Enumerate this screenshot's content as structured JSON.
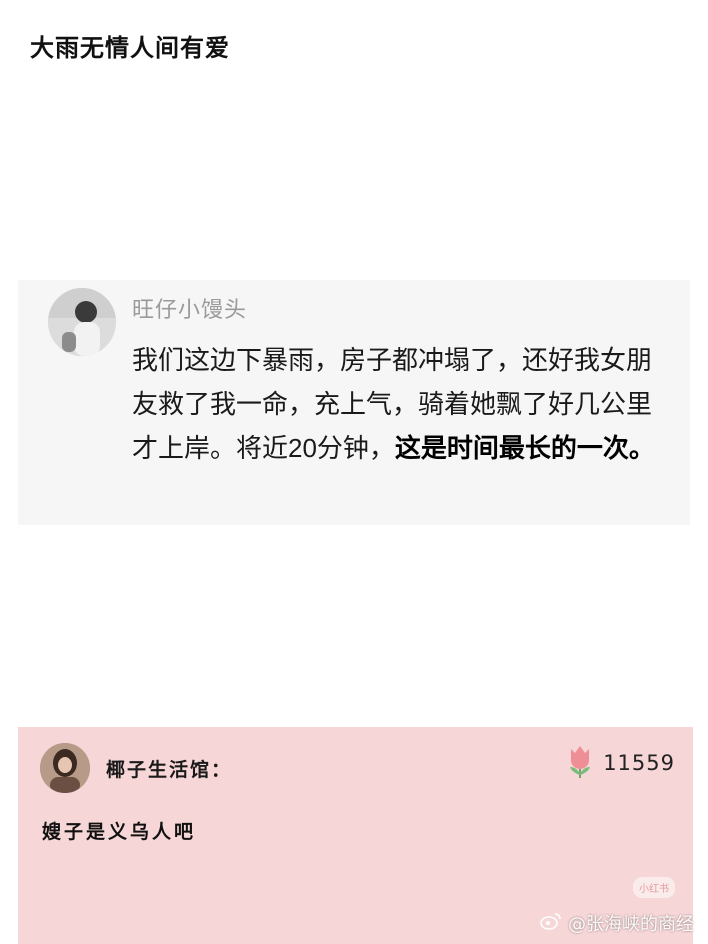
{
  "page": {
    "title": "大雨无情人间有爱"
  },
  "post": {
    "username": "旺仔小馒头",
    "content_normal": "我们这边下暴雨，房子都冲塌了，还好我女朋友救了我一命，充上气，骑着她飘了好几公里才上岸。将近20分钟，",
    "content_bold": "这是时间最长的一次。"
  },
  "comment": {
    "username": "椰子生活馆：",
    "text": "嫂子是义乌人吧",
    "like_count": "11559",
    "like_icon": "tulip-flower-icon",
    "platform_badge": "小红书"
  },
  "watermark": {
    "text": "@张海峡的商经",
    "icon": "weibo-logo-icon"
  },
  "colors": {
    "post_bg": "#f6f6f6",
    "comment_bg": "#f6d6d6",
    "username_gray": "#9a9a9a",
    "tulip_pink": "#e8868d"
  }
}
